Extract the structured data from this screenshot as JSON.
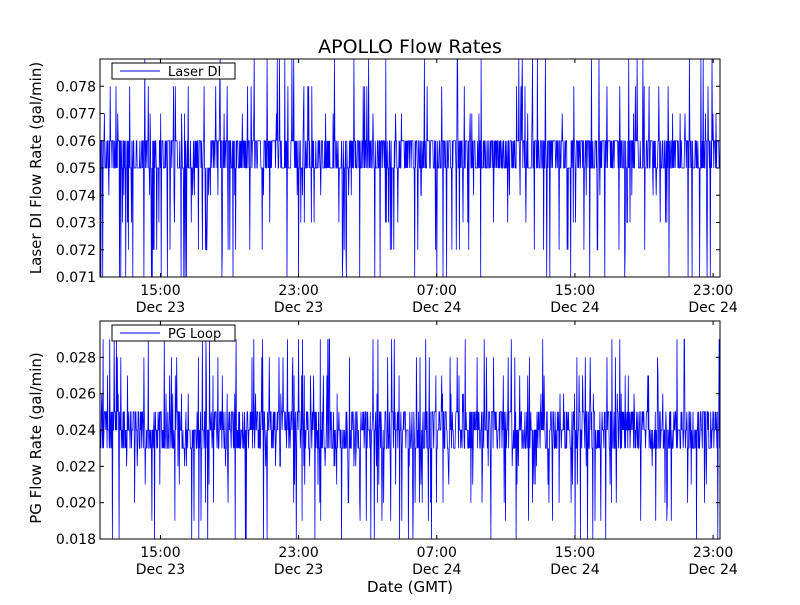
{
  "chart_data": {
    "title": "APOLLO Flow Rates",
    "xlabel": "Date (GMT)",
    "x_tick_labels": [
      {
        "time": "15:00",
        "date": "Dec 23"
      },
      {
        "time": "23:00",
        "date": "Dec 23"
      },
      {
        "time": "07:00",
        "date": "Dec 24"
      },
      {
        "time": "15:00",
        "date": "Dec 24"
      },
      {
        "time": "23:00",
        "date": "Dec 24"
      }
    ],
    "x_tick_hours": [
      15,
      23,
      31,
      39,
      47
    ],
    "xlim_hours": [
      11.5,
      47.4
    ],
    "series_color": "#0000ff",
    "panels": [
      {
        "type": "line",
        "ylabel": "Laser DI Flow Rate (gal/min)",
        "legend": "Laser DI",
        "legend_position": "top-left",
        "ylim": [
          0.071,
          0.079
        ],
        "yticks": [
          0.071,
          0.072,
          0.073,
          0.074,
          0.075,
          0.076,
          0.077,
          0.078
        ],
        "ytick_labels": [
          "0.071",
          "0.072",
          "0.073",
          "0.074",
          "0.075",
          "0.076",
          "0.077",
          "0.078"
        ],
        "baseline_range": [
          0.075,
          0.076
        ],
        "spike_levels": [
          0.071,
          0.072,
          0.073,
          0.074,
          0.077,
          0.078,
          0.079
        ],
        "observed_min": 0.071,
        "observed_max": 0.079
      },
      {
        "type": "line",
        "ylabel": "PG Flow Rate (gal/min)",
        "legend": "PG Loop",
        "legend_position": "top-left",
        "ylim": [
          0.018,
          0.03
        ],
        "yticks": [
          0.018,
          0.02,
          0.022,
          0.024,
          0.026,
          0.028
        ],
        "ytick_labels": [
          "0.018",
          "0.020",
          "0.022",
          "0.024",
          "0.026",
          "0.028"
        ],
        "baseline_range": [
          0.023,
          0.025
        ],
        "spike_levels": [
          0.018,
          0.019,
          0.02,
          0.021,
          0.022,
          0.026,
          0.027,
          0.028,
          0.029
        ],
        "observed_min": 0.018,
        "observed_max": 0.029
      }
    ]
  }
}
